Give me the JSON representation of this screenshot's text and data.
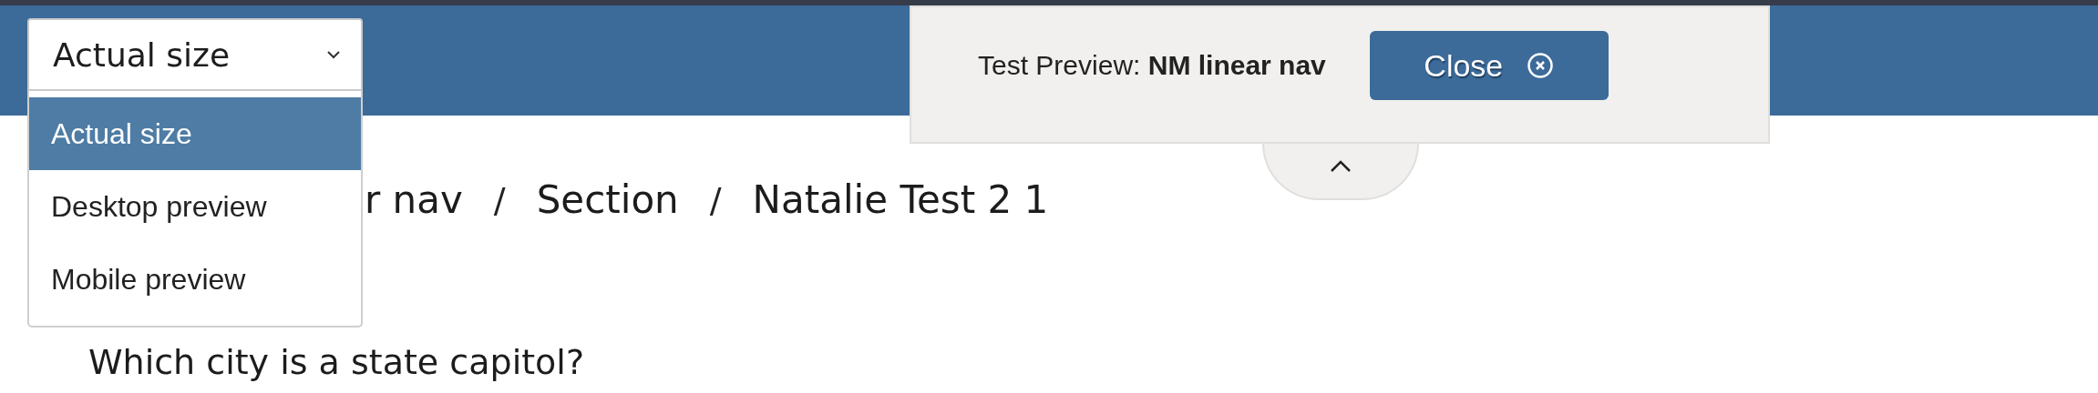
{
  "size_select": {
    "value": "Actual size",
    "expanded": true,
    "options": [
      {
        "label": "Actual size",
        "selected": true
      },
      {
        "label": "Desktop preview",
        "selected": false
      },
      {
        "label": "Mobile preview",
        "selected": false
      }
    ]
  },
  "preview_bar": {
    "text": "Test Preview: **NM linear nav**",
    "close_button": "Close"
  },
  "breadcrumb": {
    "separator": "/",
    "items": [
      "r nav",
      "Section",
      "Natalie Test 2 1"
    ]
  },
  "question": "Which city is a state capitol?"
}
